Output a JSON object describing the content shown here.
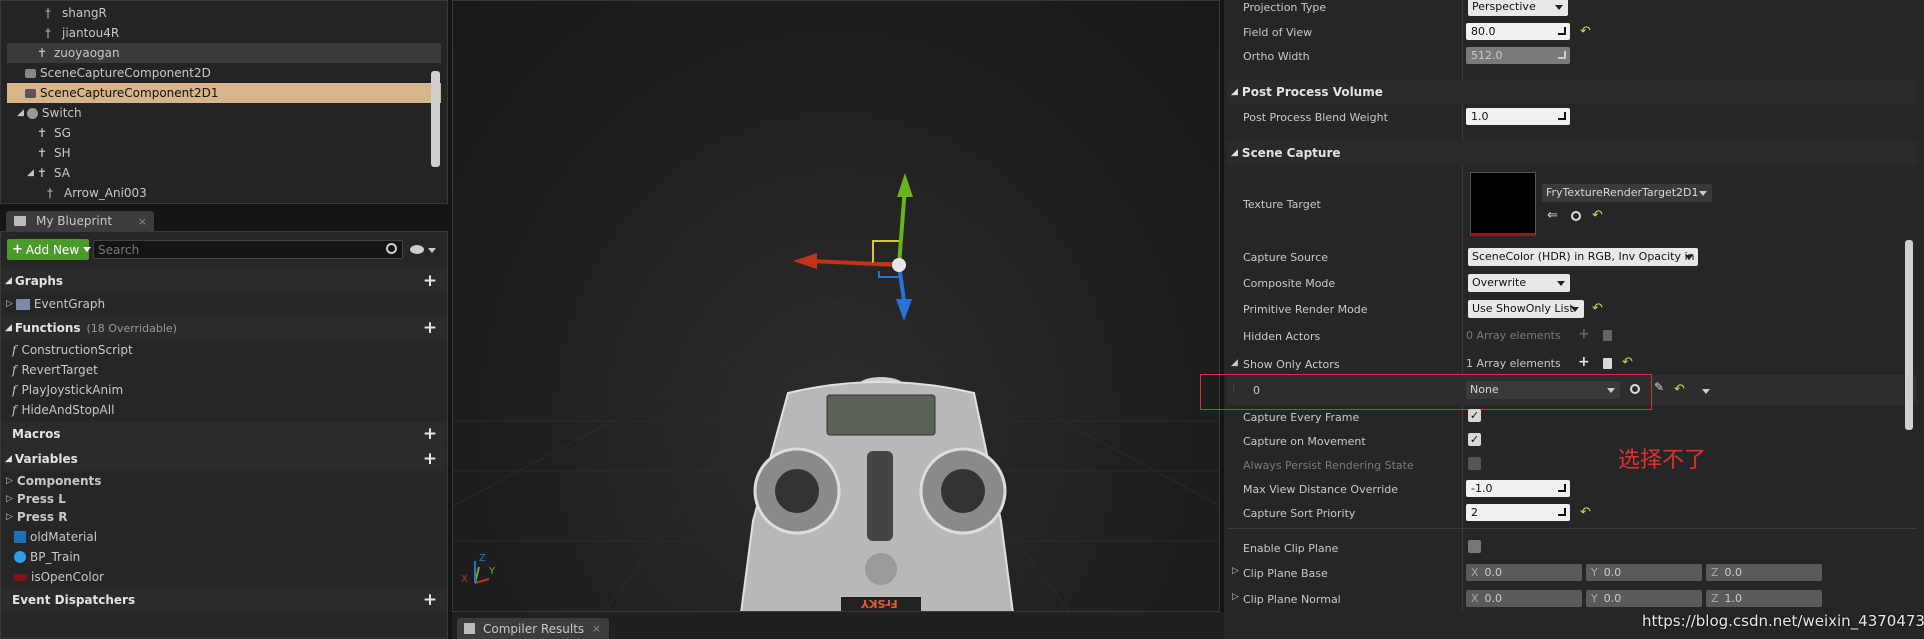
{
  "outliner": {
    "items": [
      "shangR",
      "jiantou4R",
      "zuoyaogan",
      "SceneCaptureComponent2D",
      "SceneCaptureComponent2D1",
      "Switch",
      "SG",
      "SH",
      "SA",
      "Arrow_Ani003"
    ]
  },
  "blueprint": {
    "tab_label": "My Blueprint",
    "add_new_label": "Add New",
    "search_placeholder": "Search",
    "graphs_label": "Graphs",
    "event_graph": "EventGraph",
    "functions_label": "Functions",
    "functions_count": "(18 Overridable)",
    "functions": [
      "ConstructionScript",
      "RevertTarget",
      "PlayJoystickAnim",
      "HideAndStopAll"
    ],
    "macros_label": "Macros",
    "variables_label": "Variables",
    "variable_categories": [
      "Components",
      "Press L",
      "Press R"
    ],
    "variables": [
      "oldMaterial",
      "BP_Train",
      "isOpenColor"
    ],
    "event_dispatchers_label": "Event Dispatchers"
  },
  "bottom_tab": {
    "label": "Compiler Results"
  },
  "viewport": {
    "remote_brand": "FrSKY",
    "axis_labels": [
      "X",
      "Y",
      "Z"
    ]
  },
  "details": {
    "projection_type_label": "Projection Type",
    "projection_type_value": "Perspective",
    "fov_label": "Field of View",
    "fov_value": "80.0",
    "ortho_width_label": "Ortho Width",
    "ortho_width_value": "512.0",
    "post_process_section": "Post Process Volume",
    "blend_weight_label": "Post Process Blend Weight",
    "blend_weight_value": "1.0",
    "scene_capture_section": "Scene Capture",
    "texture_target_label": "Texture Target",
    "texture_target_value": "FryTextureRenderTarget2D1",
    "capture_source_label": "Capture Source",
    "capture_source_value": "SceneColor (HDR) in RGB, Inv Opacity in A",
    "composite_mode_label": "Composite Mode",
    "composite_mode_value": "Overwrite",
    "primitive_render_label": "Primitive Render Mode",
    "primitive_render_value": "Use ShowOnly List",
    "hidden_actors_label": "Hidden Actors",
    "hidden_actors_value": "0 Array elements",
    "show_only_label": "Show Only Actors",
    "show_only_value": "1 Array elements",
    "show_only_index": "0",
    "show_only_item_value": "None",
    "capture_every_frame_label": "Capture Every Frame",
    "capture_on_movement_label": "Capture on Movement",
    "always_persist_label": "Always Persist Rendering State",
    "max_view_distance_label": "Max View Distance Override",
    "max_view_distance_value": "-1.0",
    "capture_sort_label": "Capture Sort Priority",
    "capture_sort_value": "2",
    "enable_clip_label": "Enable Clip Plane",
    "clip_base_label": "Clip Plane Base",
    "clip_base": {
      "x": "0.0",
      "y": "0.0",
      "z": "0.0"
    },
    "clip_normal_label": "Clip Plane Normal",
    "clip_normal": {
      "x": "0.0",
      "y": "0.0",
      "z": "1.0"
    },
    "axis_x": "X",
    "axis_y": "Y",
    "axis_z": "Z",
    "checkmark": "✓"
  },
  "annotation": {
    "text": "选择不了"
  },
  "watermark": "https://blog.csdn.net/weixin_43704737",
  "colors": {
    "accent_green": "#4c9a2a",
    "selection": "#d8b48a",
    "annotation_red": "#e03030",
    "highlight_box": "#d03434"
  }
}
